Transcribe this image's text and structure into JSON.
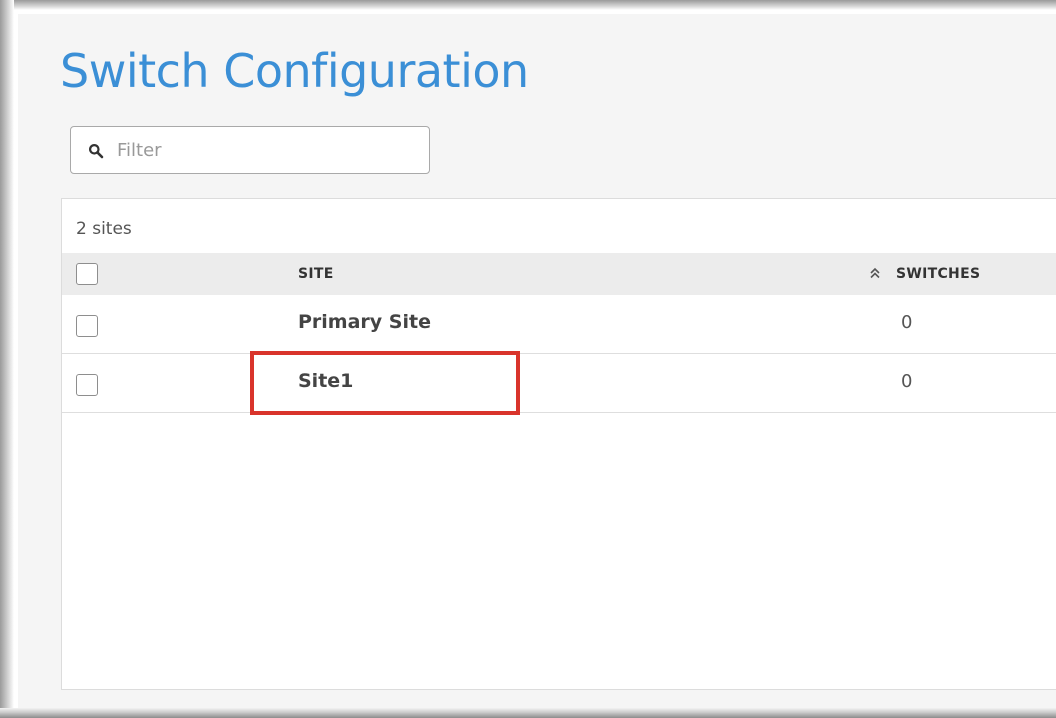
{
  "page": {
    "title": "Switch Configuration"
  },
  "filter": {
    "placeholder": "Filter",
    "value": ""
  },
  "table": {
    "count_text": "2 sites",
    "columns": {
      "site": "SITE",
      "switches": "SWITCHES"
    },
    "sort": {
      "column": "switches",
      "icon": "double-chevron-up-icon"
    },
    "rows": [
      {
        "site": "Primary Site",
        "switches": "0",
        "checked": false
      },
      {
        "site": "Site1",
        "switches": "0",
        "checked": false
      }
    ]
  },
  "annotation": {
    "highlighted_row": "Site1",
    "color": "#d9342b"
  },
  "colors": {
    "title": "#3b8fd6",
    "header_bg": "#ececec",
    "page_bg": "#f5f5f5"
  }
}
